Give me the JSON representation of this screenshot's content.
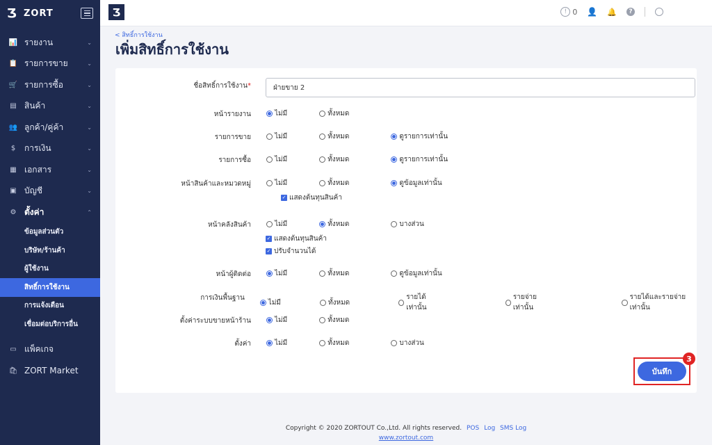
{
  "brand": {
    "logo": "Ʒ",
    "name": "ZORT"
  },
  "sidebar": {
    "items": [
      {
        "icon": "📊",
        "icon_name": "chart-icon",
        "label": "รายงาน",
        "chev": "⌄"
      },
      {
        "icon": "📋",
        "icon_name": "clipboard-icon",
        "label": "รายการขาย",
        "chev": "⌄"
      },
      {
        "icon": "🛒",
        "icon_name": "cart-icon",
        "label": "รายการซื้อ",
        "chev": "⌄"
      },
      {
        "icon": "▤",
        "icon_name": "product-box-icon",
        "label": "สินค้า",
        "chev": "⌄"
      },
      {
        "icon": "👥",
        "icon_name": "contacts-icon",
        "label": "ลูกค้า/คู่ค้า",
        "chev": "⌄"
      },
      {
        "icon": "$",
        "icon_name": "finance-icon",
        "label": "การเงิน",
        "chev": "⌄"
      },
      {
        "icon": "▦",
        "icon_name": "document-icon",
        "label": "เอกสาร",
        "chev": "⌄"
      },
      {
        "icon": "▣",
        "icon_name": "account-book-icon",
        "label": "บัญชี",
        "chev": "⌄"
      },
      {
        "icon": "⚙",
        "icon_name": "gear-icon",
        "label": "ตั้งค่า",
        "chev": "⌃"
      }
    ],
    "sub_items": [
      "ข้อมูลส่วนตัว",
      "บริษัท/ร้านค้า",
      "ผู้ใช้งาน",
      "สิทธิ์การใช้งาน",
      "การแจ้งเตือน",
      "เชื่อมต่อบริการอื่น"
    ],
    "bottom_items": [
      {
        "icon": "▭",
        "icon_name": "package-icon",
        "label": "แพ็คเกจ"
      },
      {
        "icon": "🛍",
        "icon_name": "market-bag-icon",
        "label": "ZORT Market"
      }
    ]
  },
  "topbar": {
    "logo": "Ʒ",
    "notification_count": "0"
  },
  "breadcrumb": "< สิทธิ์การใช้งาน",
  "page_title": "เพิ่มสิทธิ์การใช้งาน",
  "form": {
    "name_label": "ชื่อสิทธิ์การใช้งาน",
    "required_mark": "*",
    "name_value": "ฝ่ายขาย 2",
    "rows": [
      {
        "label": "หน้ารายงาน",
        "options": [
          "ไม่มี",
          "ทั้งหมด"
        ],
        "selected": 0
      },
      {
        "label": "รายการขาย",
        "options": [
          "ไม่มี",
          "ทั้งหมด",
          "ดูรายการเท่านั้น"
        ],
        "selected": 2
      },
      {
        "label": "รายการซื้อ",
        "options": [
          "ไม่มี",
          "ทั้งหมด",
          "ดูรายการเท่านั้น"
        ],
        "selected": 2
      },
      {
        "label": "หน้าสินค้าและหมวดหมู่",
        "options": [
          "ไม่มี",
          "ทั้งหมด",
          "ดูข้อมูลเท่านั้น"
        ],
        "selected": 2
      },
      {
        "label": "หน้าคลังสินค้า",
        "options": [
          "ไม่มี",
          "ทั้งหมด",
          "บางส่วน"
        ],
        "selected": 1
      },
      {
        "label": "หน้าผู้ติดต่อ",
        "options": [
          "ไม่มี",
          "ทั้งหมด",
          "ดูข้อมูลเท่านั้น"
        ],
        "selected": 0
      },
      {
        "label": "การเงินพื้นฐาน",
        "options": [
          "ไม่มี",
          "ทั้งหมด",
          "รายได้เท่านั้น",
          "รายจ่ายเท่านั้น",
          "รายได้และรายจ่ายเท่านั้น"
        ],
        "selected": 0
      },
      {
        "label": "ตั้งค่าระบบขายหน้าร้าน",
        "options": [
          "ไม่มี",
          "ทั้งหมด"
        ],
        "selected": 0
      },
      {
        "label": "ตั้งค่า",
        "options": [
          "ไม่มี",
          "ทั้งหมด",
          "บางส่วน"
        ],
        "selected": 0
      }
    ],
    "product_checkbox": "แสดงต้นทุนสินค้า",
    "warehouse_checkboxes": [
      "แสดงต้นทุนสินค้า",
      "ปรับจำนวนได้"
    ],
    "save_label": "บันทึก",
    "step_badge": "3"
  },
  "footer": {
    "copyright": "Copyright © 2020 ZORTOUT Co.,Ltd. All rights reserved.",
    "links": [
      "POS",
      "Log",
      "SMS Log"
    ],
    "website": "www.zortout.com"
  }
}
